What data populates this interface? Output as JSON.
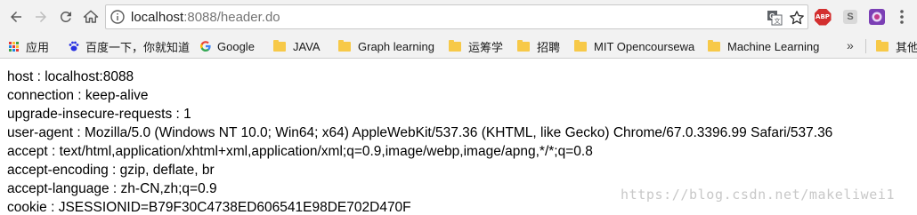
{
  "toolbar": {
    "url_host": "localhost",
    "url_port_path": ":8088/header.do",
    "back_icon": "arrow-left-icon",
    "forward_icon": "arrow-right-icon",
    "reload_icon": "reload-icon",
    "home_icon": "home-icon",
    "abp_label": "ABP",
    "ext_s_label": "S"
  },
  "bookmarks": {
    "apps_label": "应用",
    "items": [
      {
        "label": "百度一下，你就知道",
        "icon": "baidu-paw-icon"
      },
      {
        "label": "Google",
        "icon": "google-g-icon"
      },
      {
        "label": "JAVA",
        "icon": "folder-icon"
      },
      {
        "label": "Graph learning",
        "icon": "folder-icon"
      },
      {
        "label": "运筹学",
        "icon": "folder-icon"
      },
      {
        "label": "招聘",
        "icon": "folder-icon"
      },
      {
        "label": "MIT Opencoursewa",
        "icon": "folder-icon"
      },
      {
        "label": "Machine Learning",
        "icon": "folder-icon"
      },
      {
        "label": "其他",
        "icon": "folder-icon"
      }
    ],
    "overflow": "»"
  },
  "headers": [
    "host : localhost:8088",
    "connection : keep-alive",
    "upgrade-insecure-requests : 1",
    "user-agent : Mozilla/5.0 (Windows NT 10.0; Win64; x64) AppleWebKit/537.36 (KHTML, like Gecko) Chrome/67.0.3396.99 Safari/537.36",
    "accept : text/html,application/xhtml+xml,application/xml;q=0.9,image/webp,image/apng,*/*;q=0.8",
    "accept-encoding : gzip, deflate, br",
    "accept-language : zh-CN,zh;q=0.9",
    "cookie : JSESSIONID=B79F30C4738ED606541E98DE702D470F"
  ],
  "watermark": "https://blog.csdn.net/makeliwei1"
}
